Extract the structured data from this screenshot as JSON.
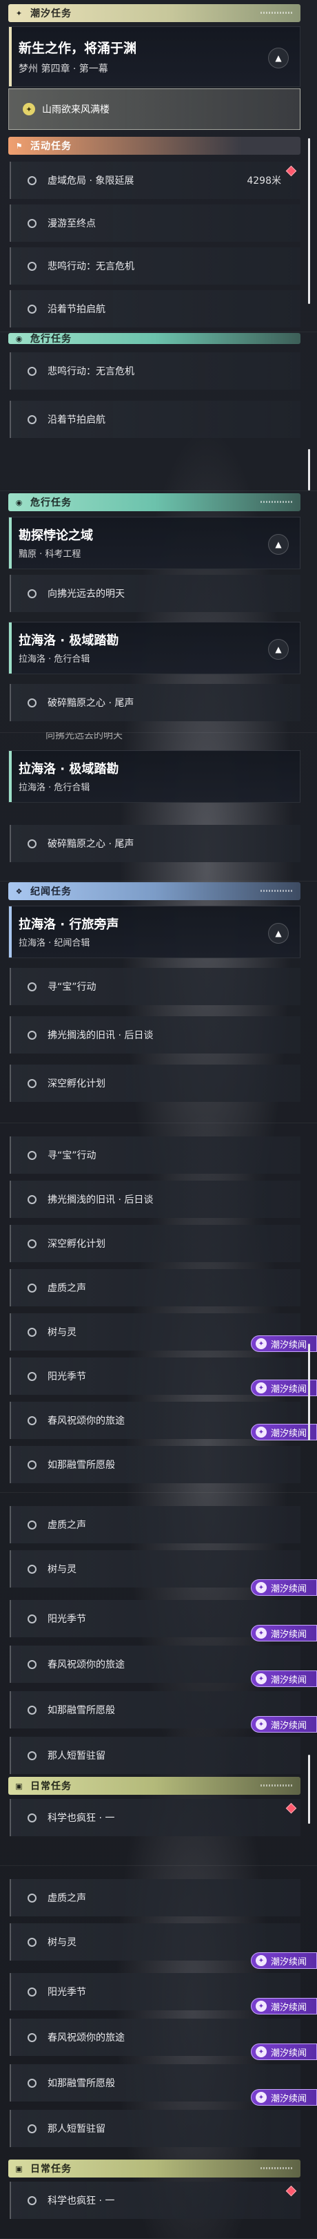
{
  "texts": {
    "chaoxi_tasks": "潮汐任务",
    "activity_tasks": "活动任务",
    "crisis_tasks": "危行任务",
    "jiwen_tasks": "纪闻任务",
    "daily_tasks": "日常任务",
    "main_title": "新生之作，将涌于渊",
    "main_sub": "梦州 第四章 · 第一幕",
    "selected_step": "山雨欲来风满楼",
    "task_xuyu": "虚域危局 · 象限延展",
    "task_xuyu_distance": "4298米",
    "task_manyou": "漫游至终点",
    "task_beiming": "悲鸣行动：无言危机",
    "task_yanzhe": "沿着节拍启航",
    "detective_title": "勘探悖论之域",
    "detective_sub": "黯原 · 科考工程",
    "detective_step": "向拂光远去的明天",
    "lahai_title": "拉海洛 · 极域踏勘",
    "lahai_sub": "拉海洛 · 危行合辑",
    "lahai_step": "破碎黯原之心 · 尾声",
    "xing_title": "拉海洛 · 行旅旁声",
    "xing_sub": "拉海洛 · 纪闻合辑",
    "xunbao": "寻“宝”行动",
    "fuguang": "拂光搁浅的旧讯 · 后日谈",
    "shenkong": "深空孵化计划",
    "xuzhi": "虚质之声",
    "shuyuling": "树与灵",
    "yangguang": "阳光季节",
    "chunfeng": "春风祝颂你的旅途",
    "xuejing": "如那融雪所愿般",
    "nashun": "那人短暂驻留",
    "kexue": "科学也疯狂 · 一",
    "continue_badge": "潮汐续闻"
  },
  "icons": {
    "chaoxi": "star-sparkle-icon",
    "activity": "activity-flag-icon",
    "crisis": "crisis-eye-icon",
    "jiwen": "bookmark-icon",
    "daily": "daily-book-icon",
    "chevron": "chevron-up-icon",
    "track": "track-diamond-icon",
    "step": "quest-step-icon",
    "badge": "chaoxi-badge-icon"
  },
  "colors": {
    "chaoxi_header": "#e9e1b8",
    "activity_header": "#f0a070",
    "crisis_header": "#9de0c8",
    "jiwen_header": "#a9c7f0",
    "daily_header": "#d8dba0",
    "badge": "#7a3fcf",
    "track_marker": "#ff5a6e"
  }
}
